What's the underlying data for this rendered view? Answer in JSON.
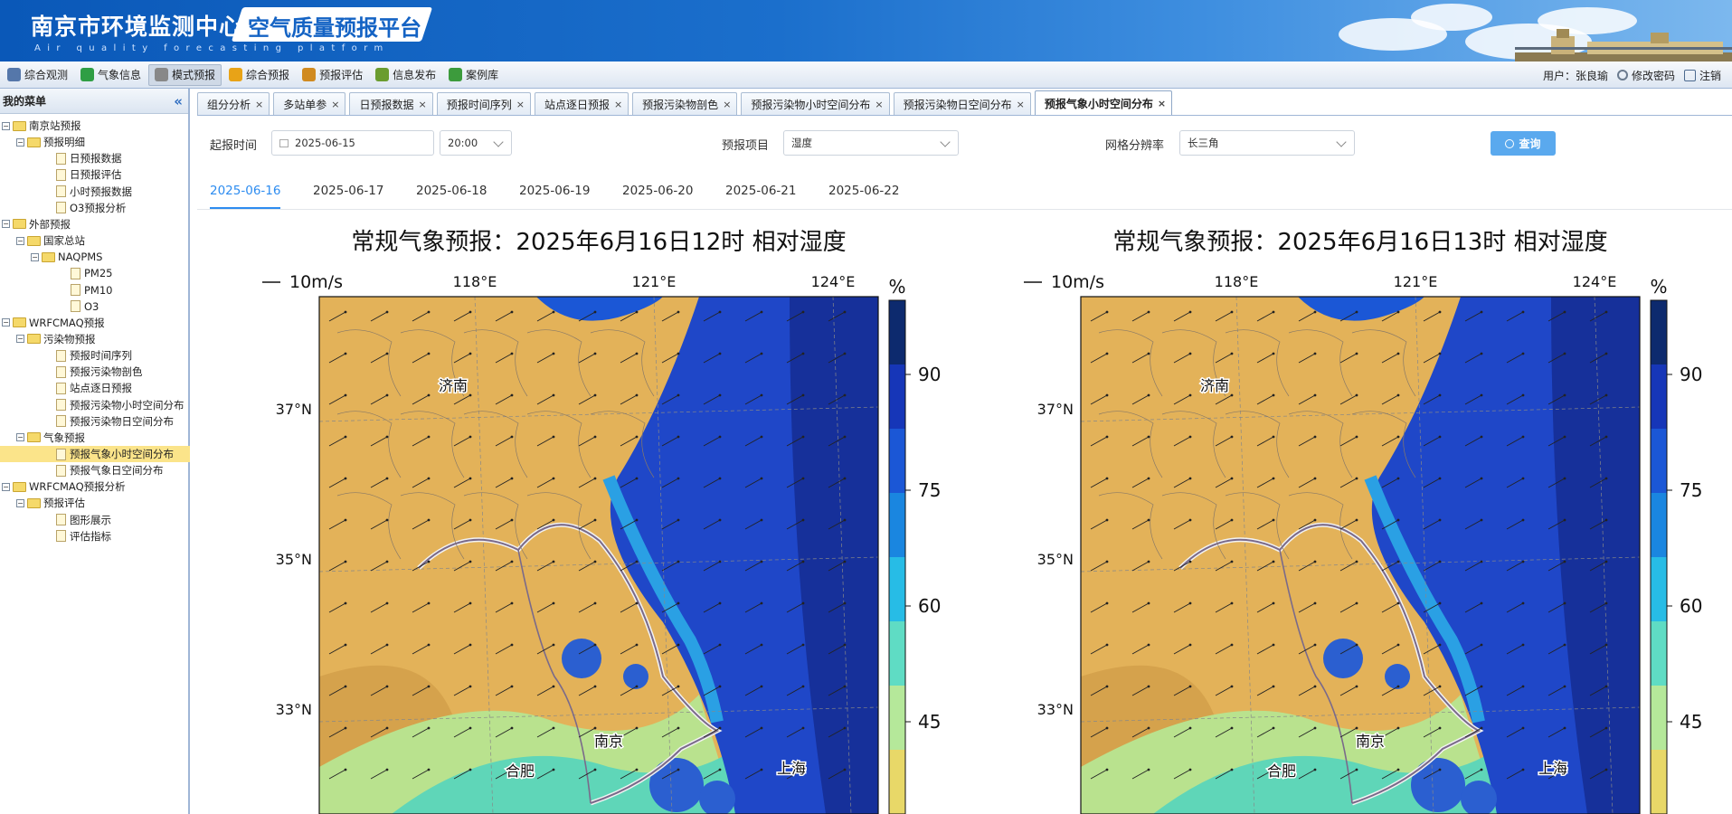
{
  "header": {
    "title_main": "南京市环境监测中心站",
    "title_platform": "空气质量预报平台",
    "subtitle": "Air quality forecasting platform"
  },
  "menu": {
    "items": [
      {
        "label": "综合观测",
        "icon": "eye-icon",
        "color": "#5577aa"
      },
      {
        "label": "气象信息",
        "icon": "globe-icon",
        "color": "#2f9e44"
      },
      {
        "label": "模式预报",
        "icon": "model-icon",
        "color": "#888888"
      },
      {
        "label": "综合预报",
        "icon": "warning-icon",
        "color": "#e8a317"
      },
      {
        "label": "预报评估",
        "icon": "megaphone-icon",
        "color": "#d08a20"
      },
      {
        "label": "信息发布",
        "icon": "broadcast-icon",
        "color": "#6a9c2f"
      },
      {
        "label": "案例库",
        "icon": "puzzle-icon",
        "color": "#3c9b3c"
      }
    ],
    "active_index": 2
  },
  "user": {
    "label": "用户：张良瑜",
    "change_password": "修改密码",
    "logout": "注销"
  },
  "sidebar": {
    "title": "我的菜单",
    "collapse_glyph": "«",
    "tree": [
      {
        "label": "南京站预报",
        "level": 0,
        "kind": "folder"
      },
      {
        "label": "预报明细",
        "level": 1,
        "kind": "folder"
      },
      {
        "label": "日预报数据",
        "level": 2,
        "kind": "leaf"
      },
      {
        "label": "日预报评估",
        "level": 2,
        "kind": "leaf"
      },
      {
        "label": "小时预报数据",
        "level": 2,
        "kind": "leaf"
      },
      {
        "label": "O3预报分析",
        "level": 2,
        "kind": "leaf"
      },
      {
        "label": "外部预报",
        "level": 0,
        "kind": "folder"
      },
      {
        "label": "国家总站",
        "level": 1,
        "kind": "folder"
      },
      {
        "label": "NAQPMS",
        "level": 2,
        "kind": "folder"
      },
      {
        "label": "PM25",
        "level": 3,
        "kind": "leaf"
      },
      {
        "label": "PM10",
        "level": 3,
        "kind": "leaf"
      },
      {
        "label": "O3",
        "level": 3,
        "kind": "leaf"
      },
      {
        "label": "WRFCMAQ预报",
        "level": 0,
        "kind": "folder"
      },
      {
        "label": "污染物预报",
        "level": 1,
        "kind": "folder"
      },
      {
        "label": "预报时间序列",
        "level": 2,
        "kind": "leaf"
      },
      {
        "label": "预报污染物剖色",
        "level": 2,
        "kind": "leaf"
      },
      {
        "label": "站点逐日预报",
        "level": 2,
        "kind": "leaf"
      },
      {
        "label": "预报污染物小时空间分布",
        "level": 2,
        "kind": "leaf"
      },
      {
        "label": "预报污染物日空间分布",
        "level": 2,
        "kind": "leaf"
      },
      {
        "label": "气象预报",
        "level": 1,
        "kind": "folder"
      },
      {
        "label": "预报气象小时空间分布",
        "level": 2,
        "kind": "leaf",
        "selected": true
      },
      {
        "label": "预报气象日空间分布",
        "level": 2,
        "kind": "leaf"
      },
      {
        "label": "WRFCMAQ预报分析",
        "level": 0,
        "kind": "folder"
      },
      {
        "label": "预报评估",
        "level": 1,
        "kind": "folder"
      },
      {
        "label": "图形展示",
        "level": 2,
        "kind": "leaf"
      },
      {
        "label": "评估指标",
        "level": 2,
        "kind": "leaf"
      }
    ]
  },
  "tabs": {
    "items": [
      "组分分析",
      "多站单参",
      "日预报数据",
      "预报时间序列",
      "站点逐日预报",
      "预报污染物剖色",
      "预报污染物小时空间分布",
      "预报污染物日空间分布",
      "预报气象小时空间分布"
    ],
    "active_index": 8,
    "close_glyph": "×"
  },
  "form": {
    "start_time_label": "起报时间",
    "start_date": "2025-06-15",
    "start_hour": "20:00",
    "item_label": "预报项目",
    "item_value": "湿度",
    "grid_label": "网格分辨率",
    "grid_value": "长三角",
    "query_button": "查询"
  },
  "date_tabs": {
    "items": [
      "2025-06-16",
      "2025-06-17",
      "2025-06-18",
      "2025-06-19",
      "2025-06-20",
      "2025-06-21",
      "2025-06-22"
    ],
    "active_index": 0
  },
  "maps": [
    {
      "title": "常规气象预报：2025年6月16日12时  相对湿度"
    },
    {
      "title": "常规气象预报：2025年6月16日13时  相对湿度"
    }
  ],
  "map_common": {
    "wind_scale": "10m/s",
    "lon_labels": [
      "118°E",
      "121°E",
      "124°E"
    ],
    "lat_labels": [
      "37°N",
      "35°N",
      "33°N"
    ],
    "cities": [
      "济南",
      "南京",
      "合肥",
      "上海"
    ],
    "colorbar_unit": "%",
    "colorbar_ticks": [
      "90",
      "75",
      "60",
      "45"
    ],
    "colorbar_colors": [
      "#0d2a6e",
      "#1636b8",
      "#1b57d6",
      "#1a86e0",
      "#27bce6",
      "#5fdcc4",
      "#b5e89a",
      "#e8d868"
    ],
    "humid_color": "#1f47c8",
    "dry_color": "#e3b259"
  }
}
